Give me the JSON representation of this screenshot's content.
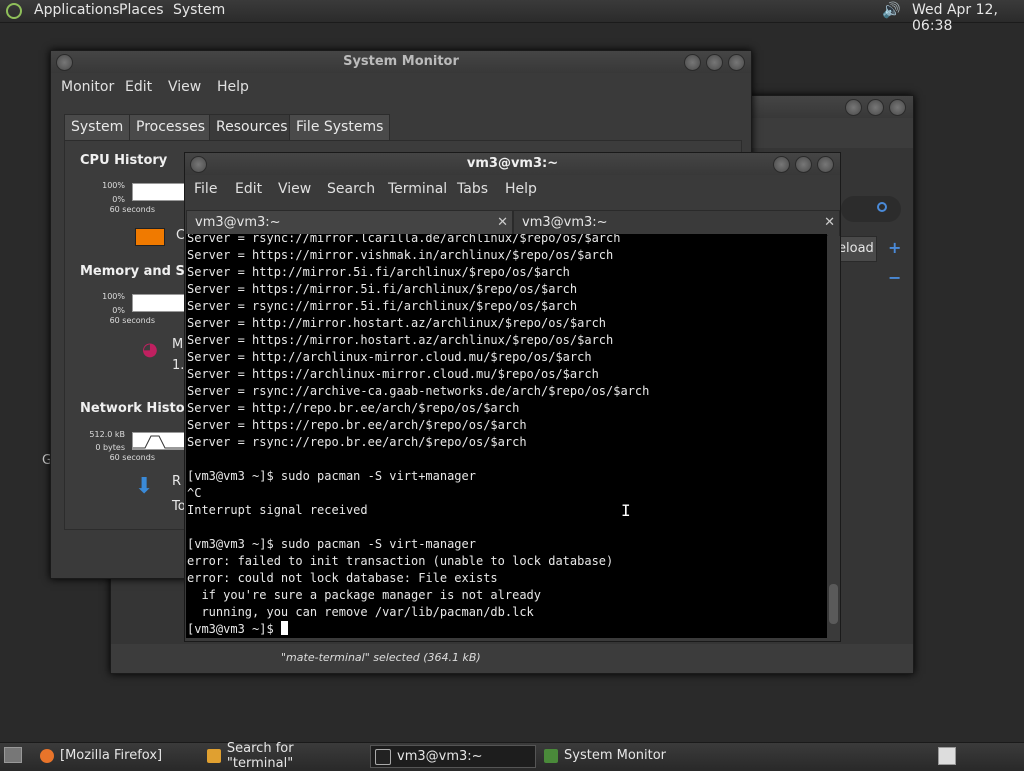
{
  "top_panel": {
    "menus": [
      "Applications",
      "Places",
      "System"
    ],
    "clock": "Wed Apr 12, 06:38"
  },
  "system_monitor": {
    "title": "System Monitor",
    "menus": [
      "Monitor",
      "Edit",
      "View",
      "Help"
    ],
    "tabs": [
      "System",
      "Processes",
      "Resources",
      "File Systems"
    ],
    "selected_tab": "Resources",
    "cpu": {
      "heading": "CPU History",
      "max": "100%",
      "min": "0%",
      "span": "60 seconds",
      "legend_partial": "C",
      "color": "#f07a00"
    },
    "memory": {
      "heading": "Memory and Swap History",
      "heading_visible": "Memory and Swa",
      "max": "100%",
      "min": "0%",
      "span": "60 seconds",
      "line1": "M",
      "line2": "1."
    },
    "network": {
      "heading": "Network History",
      "max": "512.0 kB",
      "min": "0 bytes",
      "span": "60 seconds",
      "line1": "R",
      "line2": "To"
    }
  },
  "behind_window": {
    "reload_label": "eload",
    "status": "\"mate-terminal\" selected (364.1 kB)",
    "left_char": "G"
  },
  "terminal": {
    "title": "vm3@vm3:~",
    "menus": [
      "File",
      "Edit",
      "View",
      "Search",
      "Terminal",
      "Tabs",
      "Help"
    ],
    "tabs": [
      "vm3@vm3:~",
      "vm3@vm3:~"
    ],
    "lines": [
      "Server = rsync://mirror.lcarilla.de/archlinux/$repo/os/$arch",
      "Server = https://mirror.vishmak.in/archlinux/$repo/os/$arch",
      "Server = http://mirror.5i.fi/archlinux/$repo/os/$arch",
      "Server = https://mirror.5i.fi/archlinux/$repo/os/$arch",
      "Server = rsync://mirror.5i.fi/archlinux/$repo/os/$arch",
      "Server = http://mirror.hostart.az/archlinux/$repo/os/$arch",
      "Server = https://mirror.hostart.az/archlinux/$repo/os/$arch",
      "Server = http://archlinux-mirror.cloud.mu/$repo/os/$arch",
      "Server = https://archlinux-mirror.cloud.mu/$repo/os/$arch",
      "Server = rsync://archive-ca.gaab-networks.de/arch/$repo/os/$arch",
      "Server = http://repo.br.ee/arch/$repo/os/$arch",
      "Server = https://repo.br.ee/arch/$repo/os/$arch",
      "Server = rsync://repo.br.ee/arch/$repo/os/$arch",
      "",
      "[vm3@vm3 ~]$ sudo pacman -S virt+manager",
      "^C",
      "Interrupt signal received",
      "",
      "[vm3@vm3 ~]$ sudo pacman -S virt-manager",
      "error: failed to init transaction (unable to lock database)",
      "error: could not lock database: File exists",
      "  if you're sure a package manager is not already",
      "  running, you can remove /var/lib/pacman/db.lck"
    ],
    "prompt": "[vm3@vm3 ~]$ "
  },
  "taskbar": {
    "tasks": [
      "[Mozilla Firefox]",
      "Search for \"terminal\"",
      "vm3@vm3:~",
      "System Monitor"
    ],
    "active_task": "vm3@vm3:~"
  }
}
